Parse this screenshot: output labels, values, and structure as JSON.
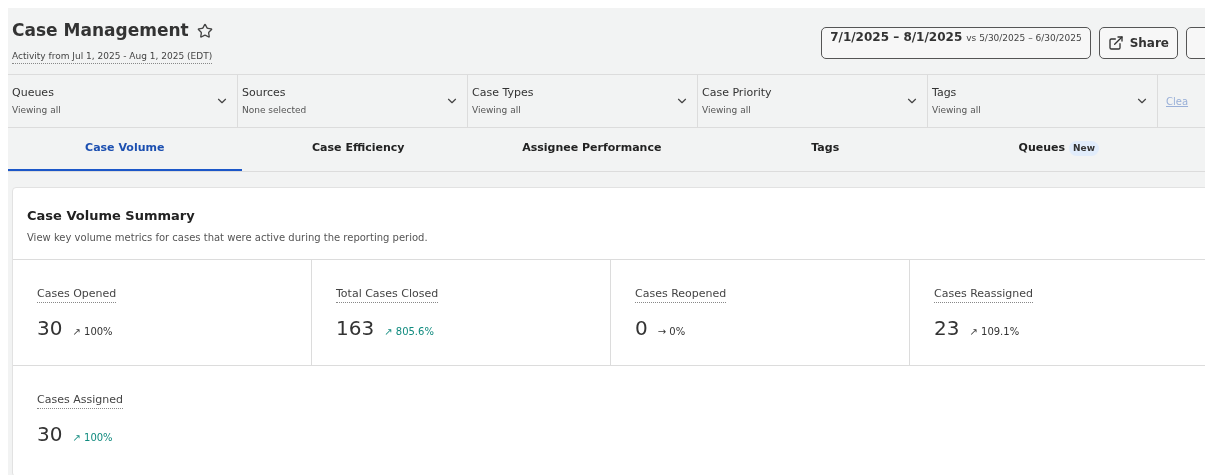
{
  "header": {
    "title": "Case Management",
    "subtitle": "Activity from Jul 1, 2025 - Aug 1, 2025 (EDT)",
    "date_range": {
      "current": "7/1/2025 – 8/1/2025",
      "compare": "vs 5/30/2025 – 6/30/2025"
    },
    "share_button": "Share"
  },
  "filters": [
    {
      "label": "Queues",
      "value": "Viewing all"
    },
    {
      "label": "Sources",
      "value": "None selected"
    },
    {
      "label": "Case Types",
      "value": "Viewing all"
    },
    {
      "label": "Case Priority",
      "value": "Viewing all"
    },
    {
      "label": "Tags",
      "value": "Viewing all"
    }
  ],
  "clear_link": "Clea",
  "tabs": [
    {
      "label": "Case Volume",
      "selected": true
    },
    {
      "label": "Case Efficiency",
      "selected": false
    },
    {
      "label": "Assignee Performance",
      "selected": false
    },
    {
      "label": "Tags",
      "selected": false
    },
    {
      "label": "Queues",
      "selected": false,
      "badge": "New"
    }
  ],
  "summary": {
    "title": "Case Volume Summary",
    "description": "View key volume metrics for cases that were active during the reporting period.",
    "metrics": [
      {
        "label": "Cases Opened",
        "value": "30",
        "arrow": "↗",
        "change": "100%",
        "color": "#333333"
      },
      {
        "label": "Total Cases Closed",
        "value": "163",
        "arrow": "↗",
        "change": "805.6%",
        "color": "#0f8a7e"
      },
      {
        "label": "Cases Reopened",
        "value": "0",
        "arrow": "→",
        "change": "0%",
        "color": "#333333"
      },
      {
        "label": "Cases Reassigned",
        "value": "23",
        "arrow": "↗",
        "change": "109.1%",
        "color": "#333333"
      },
      {
        "label": "Cases Assigned",
        "value": "30",
        "arrow": "↗",
        "change": "100%",
        "color": "#0f8a7e"
      }
    ]
  }
}
